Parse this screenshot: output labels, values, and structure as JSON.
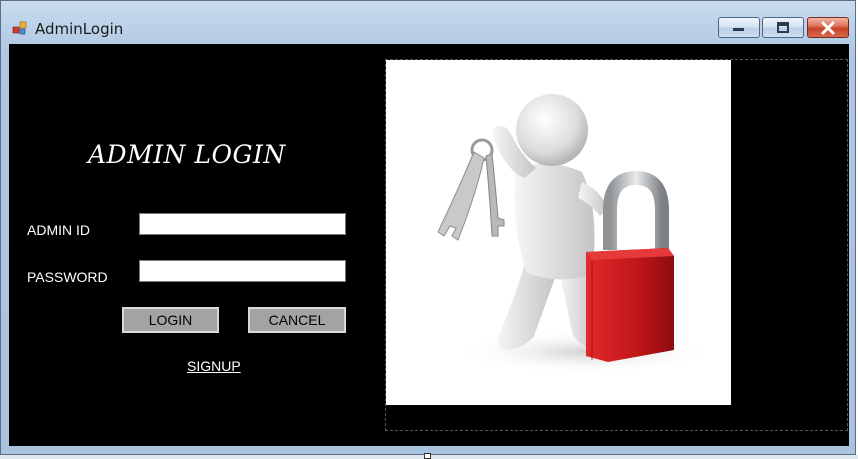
{
  "window": {
    "title": "AdminLogin",
    "controls": {
      "minimize": "minimize-icon",
      "maximize": "maximize-icon",
      "close": "close-icon"
    }
  },
  "form": {
    "heading": "ADMIN LOGIN",
    "admin_id_label": "ADMIN ID",
    "admin_id_value": "",
    "password_label": "PASSWORD",
    "password_value": "",
    "login_label": "LOGIN",
    "cancel_label": "CANCEL",
    "signup_label": "SIGNUP"
  },
  "picture": {
    "description_icon": "person-with-keys-and-padlock",
    "lock_color": "#c8161a"
  },
  "colors": {
    "form_background": "#000000",
    "button_face": "#a3a3a3",
    "title_bar": "#aec7e2"
  }
}
